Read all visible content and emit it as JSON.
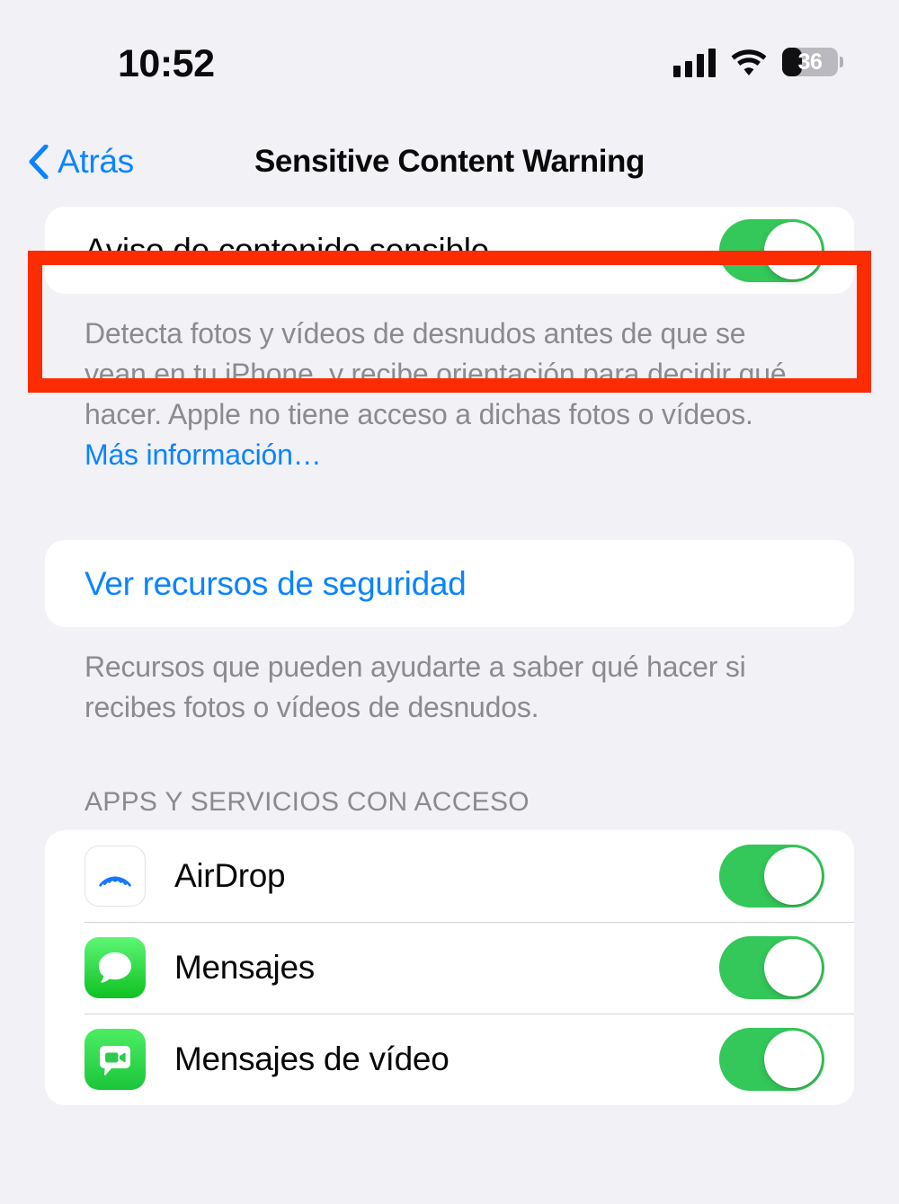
{
  "status_bar": {
    "time": "10:52",
    "signal_icon": "cellular-signal-icon",
    "wifi_icon": "wifi-icon",
    "battery_percent": "36",
    "battery_level": 36
  },
  "nav": {
    "back_label": "Atrás",
    "back_icon": "chevron-left-icon",
    "title": "Sensitive Content Warning"
  },
  "main_setting": {
    "label": "Aviso de contenido sensible",
    "toggle_state": "on",
    "footnote": "Detecta fotos y vídeos de desnudos antes de que se vean en tu iPhone, y recibe orientación para decidir qué hacer. Apple no tiene acceso a dichas fotos o vídeos. ",
    "footnote_link": "Más información…"
  },
  "resources": {
    "link_label": "Ver recursos de seguridad",
    "footnote": "Recursos que pueden ayudarte a saber qué hacer si recibes fotos o vídeos de desnudos."
  },
  "apps_section": {
    "header": "Apps y servicios con acceso",
    "items": [
      {
        "name": "AirDrop",
        "icon": "airdrop-icon",
        "toggle_state": "on"
      },
      {
        "name": "Mensajes",
        "icon": "messages-icon",
        "toggle_state": "on"
      },
      {
        "name": "Mensajes de vídeo",
        "icon": "video-messages-icon",
        "toggle_state": "on"
      }
    ]
  },
  "annotation": {
    "highlight_color": "#FC2C02",
    "highlight_target": "Aviso de contenido sensible"
  },
  "colors": {
    "background": "#F1F1F6",
    "card": "#FFFFFF",
    "accent_blue": "#0A84FF",
    "toggle_green": "#34C759",
    "secondary_text": "#8A8A8F"
  }
}
